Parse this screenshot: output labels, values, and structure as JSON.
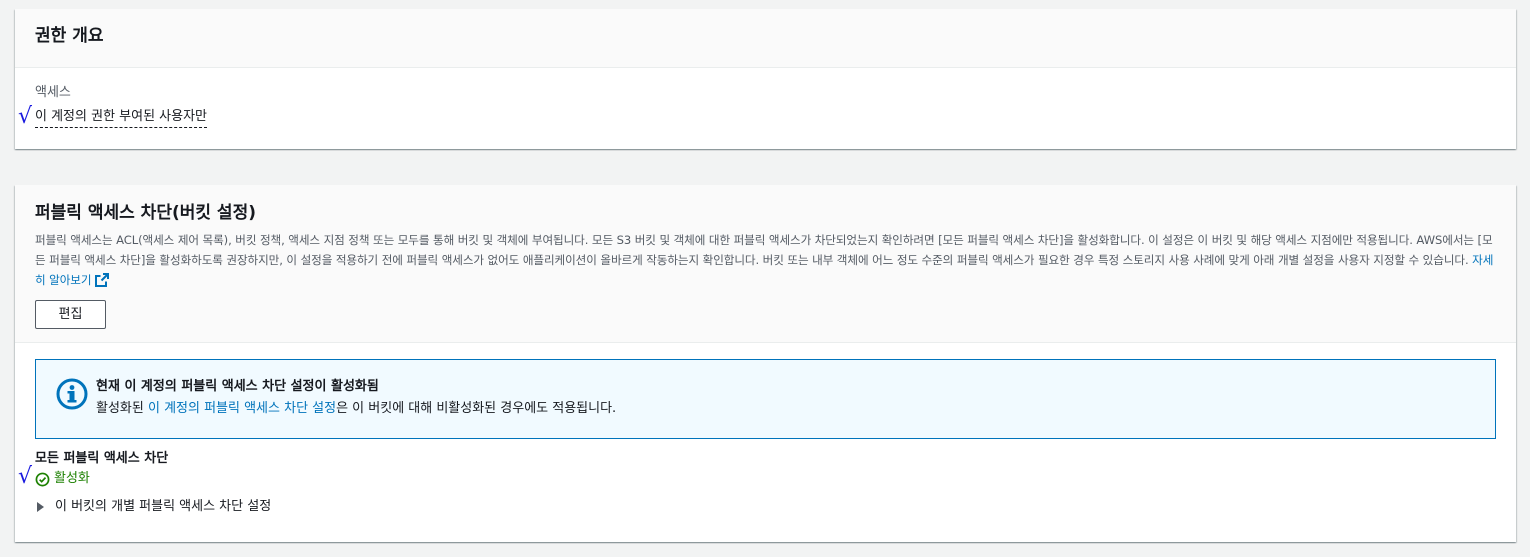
{
  "overview": {
    "title": "권한 개요",
    "access_label": "액세스",
    "access_value": "이 계정의 권한 부여된 사용자만"
  },
  "bpa": {
    "title": "퍼블릭 액세스 차단(버킷 설정)",
    "description": "퍼블릭 액세스는 ACL(액세스 제어 목록), 버킷 정책, 액세스 지점 정책 또는 모두를 통해 버킷 및 객체에 부여됩니다. 모든 S3 버킷 및 객체에 대한 퍼블릭 액세스가 차단되었는지 확인하려면 [모든 퍼블릭 액세스 차단]을 활성화합니다. 이 설정은 이 버킷 및 해당 액세스 지점에만 적용됩니다. AWS에서는 [모든 퍼블릭 액세스 차단]을 활성화하도록 권장하지만, 이 설정을 적용하기 전에 퍼블릭 액세스가 없어도 애플리케이션이 올바르게 작동하는지 확인합니다. 버킷 또는 내부 객체에 어느 정도 수준의 퍼블릭 액세스가 필요한 경우 특정 스토리지 사용 사례에 맞게 아래 개별 설정을 사용자 지정할 수 있습니다.",
    "learn_more": "자세히 알아보기",
    "edit_label": "편집",
    "alert": {
      "title": "현재 이 계정의 퍼블릭 액세스 차단 설정이 활성화됨",
      "text_prefix": "활성화된 ",
      "text_link": "이 계정의 퍼블릭 액세스 차단 설정",
      "text_suffix": "은 이 버킷에 대해 비활성화된 경우에도 적용됩니다."
    },
    "block_all_label": "모든 퍼블릭 액세스 차단",
    "block_all_status": "활성화",
    "expander_label": "이 버킷의 개별 퍼블릭 액세스 차단 설정"
  },
  "annotations": {
    "check_mark": "√"
  },
  "colors": {
    "link": "#0073bb",
    "success": "#1d8102",
    "info_border": "#0073bb",
    "annotation": "#1a1adf"
  },
  "icons": {
    "info": "info-icon",
    "external_link": "external-link-icon",
    "status_success": "check-circle-icon",
    "expand": "caret-right-icon"
  }
}
